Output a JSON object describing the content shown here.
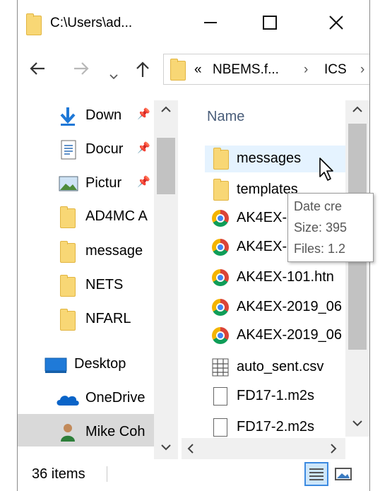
{
  "window": {
    "title": "C:\\Users\\ad...",
    "minimize_icon": "minimize-icon",
    "maximize_icon": "maximize-icon",
    "close_icon": "close-icon"
  },
  "nav": {
    "back_icon": "arrow-left-icon",
    "forward_icon": "arrow-right-icon",
    "recent_icon": "chevron-down-icon",
    "up_icon": "arrow-up-icon"
  },
  "address": {
    "overflow": "«",
    "segments": [
      "NBEMS.f...",
      "ICS"
    ],
    "separator": "›"
  },
  "sidebar": {
    "items": [
      {
        "label": "Down",
        "icon": "download-arrow-icon",
        "pinned": true
      },
      {
        "label": "Docur",
        "icon": "document-icon",
        "pinned": true
      },
      {
        "label": "Pictur",
        "icon": "pictures-icon",
        "pinned": true
      },
      {
        "label": "AD4MC A",
        "icon": "folder-icon",
        "pinned": false
      },
      {
        "label": "message",
        "icon": "folder-icon",
        "pinned": false
      },
      {
        "label": "NETS",
        "icon": "folder-icon",
        "pinned": false
      },
      {
        "label": "NFARL",
        "icon": "folder-icon",
        "pinned": false
      },
      {
        "label": "Desktop",
        "icon": "desktop-icon",
        "pinned": false
      },
      {
        "label": "OneDrive",
        "icon": "cloud-icon",
        "pinned": false
      },
      {
        "label": "Mike Coh",
        "icon": "user-icon",
        "pinned": false
      }
    ]
  },
  "filelist": {
    "header": "Name",
    "files": [
      {
        "name": "messages",
        "icon": "folder-icon"
      },
      {
        "name": "templates",
        "icon": "folder-icon"
      },
      {
        "name": "AK4EX-5",
        "icon": "chrome-icon"
      },
      {
        "name": "AK4EX-5",
        "icon": "chrome-icon"
      },
      {
        "name": "AK4EX-101.htn",
        "icon": "chrome-icon"
      },
      {
        "name": "AK4EX-2019_06",
        "icon": "chrome-icon"
      },
      {
        "name": "AK4EX-2019_06",
        "icon": "chrome-icon"
      },
      {
        "name": "auto_sent.csv",
        "icon": "spreadsheet-icon"
      },
      {
        "name": "FD17-1.m2s",
        "icon": "document-icon"
      },
      {
        "name": "FD17-2.m2s",
        "icon": "document-icon"
      }
    ]
  },
  "tooltip": {
    "line1": "Date cre",
    "line2": "Size: 395",
    "line3": "Files: 1.2"
  },
  "status": {
    "items_count": "36 items"
  }
}
